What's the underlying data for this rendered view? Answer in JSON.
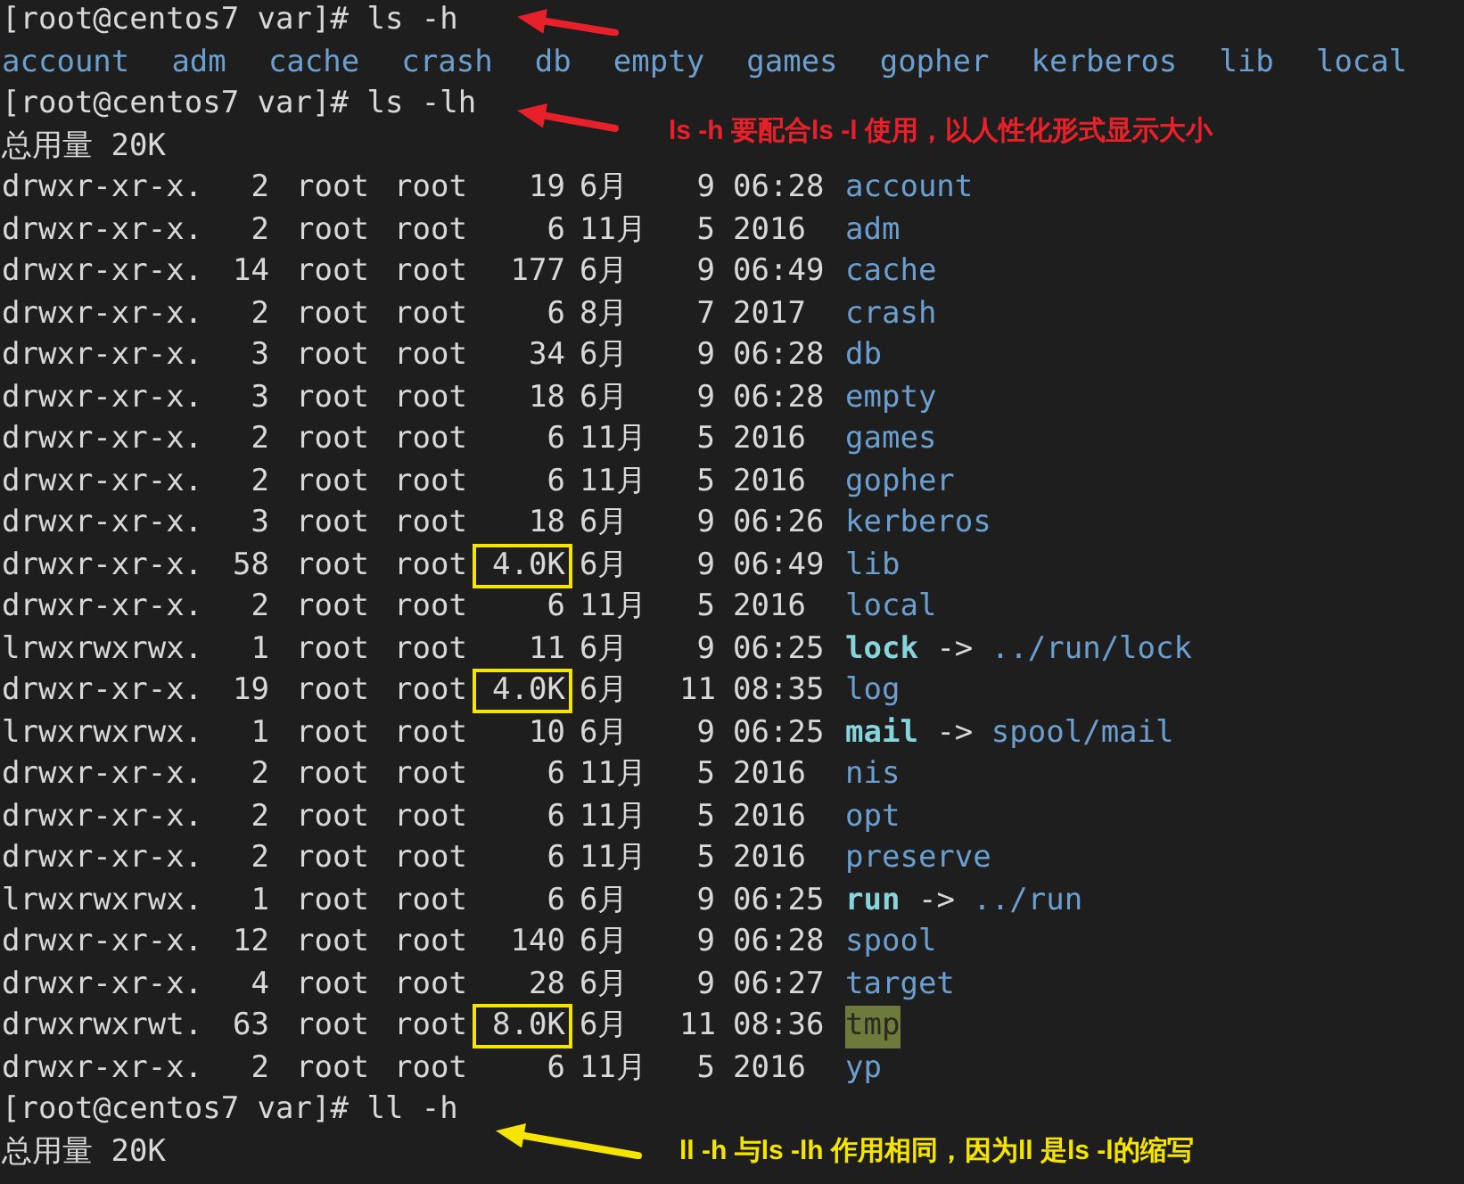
{
  "terminal": {
    "lines": [
      {
        "kind": "prompt",
        "prompt": "[root@centos7 var]#",
        "command": "ls -h"
      },
      {
        "kind": "names",
        "items": [
          "account",
          "adm",
          "cache",
          "crash",
          "db",
          "empty",
          "games",
          "gopher",
          "kerberos",
          "lib",
          "local"
        ]
      },
      {
        "kind": "prompt",
        "prompt": "[root@centos7 var]#",
        "command": "ls -lh"
      },
      {
        "kind": "text",
        "text": "总用量 20K"
      },
      {
        "kind": "entry",
        "mode": "drwxr-xr-x.",
        "links": "2",
        "owner": "root",
        "group": "root",
        "size": "19",
        "boxed": false,
        "month": "6月",
        "day": "9",
        "time": "06:28",
        "name": "account",
        "symlink": false,
        "sticky": false
      },
      {
        "kind": "entry",
        "mode": "drwxr-xr-x.",
        "links": "2",
        "owner": "root",
        "group": "root",
        "size": "6",
        "boxed": false,
        "month": "11月",
        "day": "5",
        "time": "2016",
        "name": "adm",
        "symlink": false,
        "sticky": false
      },
      {
        "kind": "entry",
        "mode": "drwxr-xr-x.",
        "links": "14",
        "owner": "root",
        "group": "root",
        "size": "177",
        "boxed": false,
        "month": "6月",
        "day": "9",
        "time": "06:49",
        "name": "cache",
        "symlink": false,
        "sticky": false
      },
      {
        "kind": "entry",
        "mode": "drwxr-xr-x.",
        "links": "2",
        "owner": "root",
        "group": "root",
        "size": "6",
        "boxed": false,
        "month": "8月",
        "day": "7",
        "time": "2017",
        "name": "crash",
        "symlink": false,
        "sticky": false
      },
      {
        "kind": "entry",
        "mode": "drwxr-xr-x.",
        "links": "3",
        "owner": "root",
        "group": "root",
        "size": "34",
        "boxed": false,
        "month": "6月",
        "day": "9",
        "time": "06:28",
        "name": "db",
        "symlink": false,
        "sticky": false
      },
      {
        "kind": "entry",
        "mode": "drwxr-xr-x.",
        "links": "3",
        "owner": "root",
        "group": "root",
        "size": "18",
        "boxed": false,
        "month": "6月",
        "day": "9",
        "time": "06:28",
        "name": "empty",
        "symlink": false,
        "sticky": false
      },
      {
        "kind": "entry",
        "mode": "drwxr-xr-x.",
        "links": "2",
        "owner": "root",
        "group": "root",
        "size": "6",
        "boxed": false,
        "month": "11月",
        "day": "5",
        "time": "2016",
        "name": "games",
        "symlink": false,
        "sticky": false
      },
      {
        "kind": "entry",
        "mode": "drwxr-xr-x.",
        "links": "2",
        "owner": "root",
        "group": "root",
        "size": "6",
        "boxed": false,
        "month": "11月",
        "day": "5",
        "time": "2016",
        "name": "gopher",
        "symlink": false,
        "sticky": false
      },
      {
        "kind": "entry",
        "mode": "drwxr-xr-x.",
        "links": "3",
        "owner": "root",
        "group": "root",
        "size": "18",
        "boxed": false,
        "month": "6月",
        "day": "9",
        "time": "06:26",
        "name": "kerberos",
        "symlink": false,
        "sticky": false
      },
      {
        "kind": "entry",
        "mode": "drwxr-xr-x.",
        "links": "58",
        "owner": "root",
        "group": "root",
        "size": "4.0K",
        "boxed": true,
        "month": "6月",
        "day": "9",
        "time": "06:49",
        "name": "lib",
        "symlink": false,
        "sticky": false
      },
      {
        "kind": "entry",
        "mode": "drwxr-xr-x.",
        "links": "2",
        "owner": "root",
        "group": "root",
        "size": "6",
        "boxed": false,
        "month": "11月",
        "day": "5",
        "time": "2016",
        "name": "local",
        "symlink": false,
        "sticky": false
      },
      {
        "kind": "entry",
        "mode": "lrwxrwxrwx.",
        "links": "1",
        "owner": "root",
        "group": "root",
        "size": "11",
        "boxed": false,
        "month": "6月",
        "day": "9",
        "time": "06:25",
        "name": "lock",
        "symlink": true,
        "sticky": false,
        "arrow": "->",
        "target": "../run/lock"
      },
      {
        "kind": "entry",
        "mode": "drwxr-xr-x.",
        "links": "19",
        "owner": "root",
        "group": "root",
        "size": "4.0K",
        "boxed": true,
        "month": "6月",
        "day": "11",
        "time": "08:35",
        "name": "log",
        "symlink": false,
        "sticky": false
      },
      {
        "kind": "entry",
        "mode": "lrwxrwxrwx.",
        "links": "1",
        "owner": "root",
        "group": "root",
        "size": "10",
        "boxed": false,
        "month": "6月",
        "day": "9",
        "time": "06:25",
        "name": "mail",
        "symlink": true,
        "sticky": false,
        "arrow": "->",
        "target": "spool/mail"
      },
      {
        "kind": "entry",
        "mode": "drwxr-xr-x.",
        "links": "2",
        "owner": "root",
        "group": "root",
        "size": "6",
        "boxed": false,
        "month": "11月",
        "day": "5",
        "time": "2016",
        "name": "nis",
        "symlink": false,
        "sticky": false
      },
      {
        "kind": "entry",
        "mode": "drwxr-xr-x.",
        "links": "2",
        "owner": "root",
        "group": "root",
        "size": "6",
        "boxed": false,
        "month": "11月",
        "day": "5",
        "time": "2016",
        "name": "opt",
        "symlink": false,
        "sticky": false
      },
      {
        "kind": "entry",
        "mode": "drwxr-xr-x.",
        "links": "2",
        "owner": "root",
        "group": "root",
        "size": "6",
        "boxed": false,
        "month": "11月",
        "day": "5",
        "time": "2016",
        "name": "preserve",
        "symlink": false,
        "sticky": false
      },
      {
        "kind": "entry",
        "mode": "lrwxrwxrwx.",
        "links": "1",
        "owner": "root",
        "group": "root",
        "size": "6",
        "boxed": false,
        "month": "6月",
        "day": "9",
        "time": "06:25",
        "name": "run",
        "symlink": true,
        "sticky": false,
        "arrow": "->",
        "target": "../run"
      },
      {
        "kind": "entry",
        "mode": "drwxr-xr-x.",
        "links": "12",
        "owner": "root",
        "group": "root",
        "size": "140",
        "boxed": false,
        "month": "6月",
        "day": "9",
        "time": "06:28",
        "name": "spool",
        "symlink": false,
        "sticky": false
      },
      {
        "kind": "entry",
        "mode": "drwxr-xr-x.",
        "links": "4",
        "owner": "root",
        "group": "root",
        "size": "28",
        "boxed": false,
        "month": "6月",
        "day": "9",
        "time": "06:27",
        "name": "target",
        "symlink": false,
        "sticky": false
      },
      {
        "kind": "entry",
        "mode": "drwxrwxrwt.",
        "links": "63",
        "owner": "root",
        "group": "root",
        "size": "8.0K",
        "boxed": true,
        "month": "6月",
        "day": "11",
        "time": "08:36",
        "name": "tmp",
        "symlink": false,
        "sticky": true
      },
      {
        "kind": "entry",
        "mode": "drwxr-xr-x.",
        "links": "2",
        "owner": "root",
        "group": "root",
        "size": "6",
        "boxed": false,
        "month": "11月",
        "day": "5",
        "time": "2016",
        "name": "yp",
        "symlink": false,
        "sticky": false
      },
      {
        "kind": "prompt",
        "prompt": "[root@centos7 var]#",
        "command": "ll -h"
      },
      {
        "kind": "text",
        "text": "总用量 20K"
      }
    ]
  },
  "annotations": [
    {
      "text": "ls -h 要配合ls -l 使用，以人性化形式显示大小",
      "color": "#e8202a"
    },
    {
      "text": "ll -h 与ls -lh 作用相同，因为ll 是ls -l的缩写",
      "color": "#f5e400"
    }
  ],
  "arrows": [
    {
      "color": "#e8202a"
    },
    {
      "color": "#e8202a"
    },
    {
      "color": "#f5e400"
    }
  ]
}
